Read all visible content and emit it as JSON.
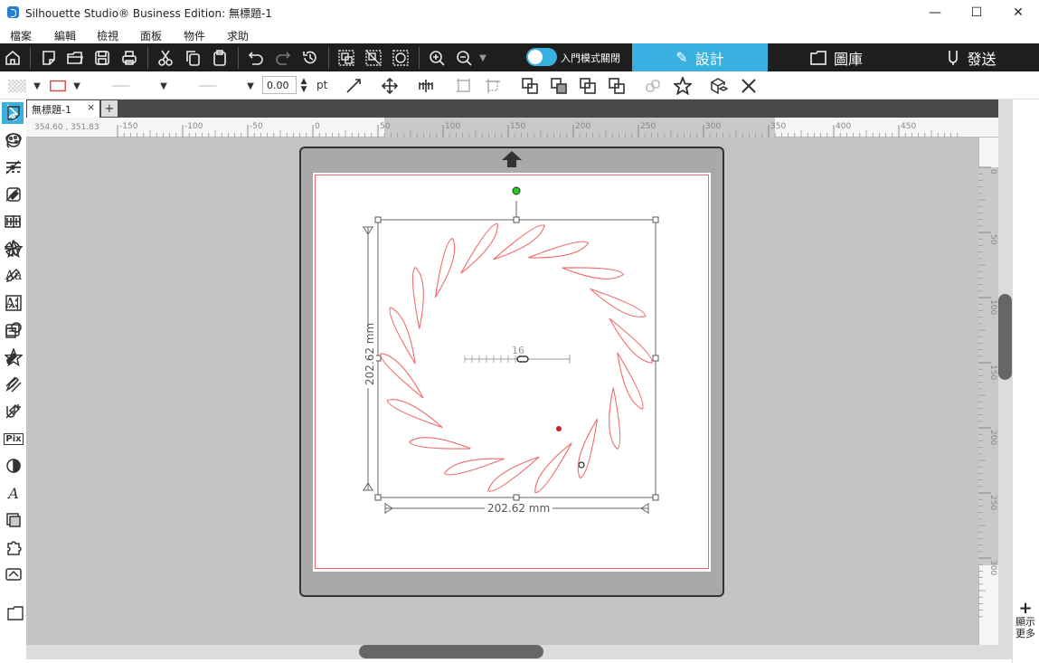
{
  "window": {
    "title": "Silhouette Studio® Business Edition: 無標題-1",
    "minimize": "—",
    "maximize": "☐",
    "close": "✕"
  },
  "menu": [
    "檔案",
    "編輯",
    "檢視",
    "面板",
    "物件",
    "求助"
  ],
  "toolbar": {
    "beginner_mode_label": "入門模式關閉",
    "tabs": {
      "design": "設計",
      "library": "圖庫",
      "send": "發送"
    }
  },
  "properties": {
    "line_width_value": "0.00",
    "unit": "pt"
  },
  "document": {
    "tab_label": "無標題-1",
    "tab_close": "×",
    "add_tab": "+",
    "coordinates": "354.60 , 351.83"
  },
  "ruler": {
    "top_ticks": [
      "-150",
      "-100",
      "-50",
      "0",
      "50",
      "100",
      "150",
      "200",
      "250",
      "300",
      "350",
      "400",
      "450"
    ],
    "right_ticks": [
      "0",
      "50",
      "100",
      "150",
      "200",
      "250",
      "300"
    ]
  },
  "selection": {
    "width_label": "202.62 mm",
    "height_label": "202.62 mm",
    "slider_value": "16"
  },
  "sidebar": {
    "show_more": "顯示更多"
  },
  "colors": {
    "accent": "#39b1e0",
    "dark_toolbar": "#1e1e1e",
    "cut_line": "#f06a6a"
  }
}
